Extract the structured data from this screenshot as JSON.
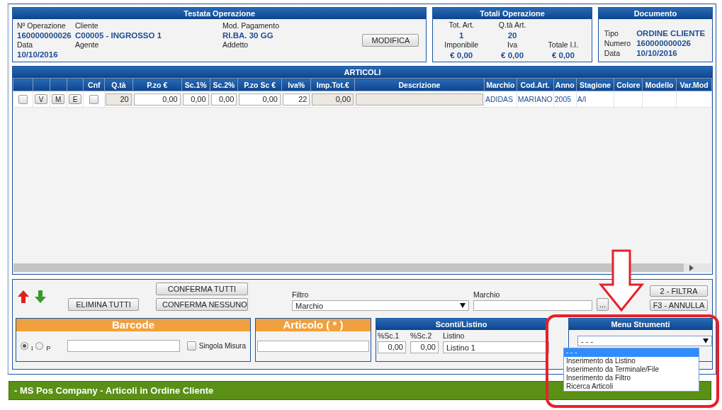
{
  "testata": {
    "title": "Testata Operazione",
    "fields": [
      {
        "label": "Nº Operazione",
        "value": "160000000026"
      },
      {
        "label": "Cliente",
        "value": "C00005 - INGROSSO 1"
      },
      {
        "label": "Mod. Pagamento",
        "value": "RI.BA. 30 GG"
      },
      {
        "label": "Data",
        "value": "10/10/2016"
      },
      {
        "label": "Agente"
      },
      {
        "label": "Addetto"
      }
    ],
    "button": "MODIFICA"
  },
  "totali": {
    "title": "Totali Operazione",
    "rows": [
      [
        {
          "label": "Tot. Art.",
          "value": "1"
        },
        {
          "label": "Q.tà Art.",
          "value": "20"
        }
      ],
      [
        {
          "label": "Imponibile",
          "value": "€ 0,00"
        },
        {
          "label": "Iva",
          "value": "€ 0,00"
        },
        {
          "label": "Totale I.I.",
          "value": "€ 0,00"
        }
      ]
    ]
  },
  "documento": {
    "title": "Documento",
    "fields": [
      {
        "label": "Tipo",
        "value": "ORDINE CLIENTE"
      },
      {
        "label": "Numero",
        "value": "160000000026"
      },
      {
        "label": "Data",
        "value": "10/10/2016"
      }
    ]
  },
  "articoli": {
    "title": "ARTICOLI",
    "columns": [
      {},
      {},
      {},
      {},
      {
        "label": "Cnf"
      },
      {
        "label": "Q.tà"
      },
      {
        "label": "P.zo €"
      },
      {
        "label": "Sc.1%"
      },
      {
        "label": "Sc.2%"
      },
      {
        "label": "P.zo Sc €"
      },
      {
        "label": "Iva%"
      },
      {
        "label": "Imp.Tot.€"
      },
      {
        "label": "Descrizione"
      },
      {
        "label": "Marchio"
      },
      {
        "label": "Cod.Art."
      },
      {
        "label": "Anno"
      },
      {
        "label": "Stagione"
      },
      {
        "label": "Colore"
      },
      {
        "label": "Modello"
      },
      {
        "label": "Var.Mod"
      }
    ],
    "rows": [
      [
        {
          "kind": "checkbox",
          "checked": false
        },
        {
          "kind": "button",
          "value": "V"
        },
        {
          "kind": "button",
          "value": "M"
        },
        {
          "kind": "button",
          "value": "E"
        },
        {
          "kind": "checkbox",
          "checked": false
        },
        {
          "kind": "readonly",
          "value": "20"
        },
        {
          "kind": "input",
          "value": "0,00"
        },
        {
          "kind": "input",
          "value": "0,00"
        },
        {
          "kind": "input",
          "value": "0,00"
        },
        {
          "kind": "input",
          "value": "0,00"
        },
        {
          "kind": "input",
          "value": "22"
        },
        {
          "kind": "readonly",
          "value": "0,00"
        },
        {
          "kind": "readonly"
        },
        {
          "kind": "text",
          "value": "ADIDAS"
        },
        {
          "kind": "text",
          "value": "MARIANO"
        },
        {
          "kind": "text",
          "value": "2005"
        },
        {
          "kind": "text",
          "value": "A/I"
        },
        {
          "kind": "text"
        },
        {
          "kind": "text"
        },
        {
          "kind": "text"
        }
      ]
    ]
  },
  "toolbar": {
    "elimina": "ELIMINA TUTTI",
    "conferma_tutti": "CONFERMA TUTTI",
    "conferma_nessuno": "CONFERMA NESSUNO",
    "filtro": {
      "label": "Filtro",
      "value": "Marchio"
    },
    "marchio": {
      "label": "Marchio",
      "button": "..."
    },
    "filtra": "2 - FILTRA",
    "annulla": "F3 - ANNULLA"
  },
  "barcode": {
    "title": "Barcode",
    "modes": [
      {
        "label": "I",
        "selected": true
      },
      {
        "label": "P",
        "selected": false
      }
    ],
    "singola_misura": {
      "label": "Singola Misura",
      "checked": false
    }
  },
  "articolo": {
    "title": "Articolo ( * )"
  },
  "sconti": {
    "title": "Sconti/Listino",
    "sc1": {
      "label": "%Sc.1",
      "value": "0,00"
    },
    "sc2": {
      "label": "%Sc.2",
      "value": "0,00"
    },
    "listino": {
      "label": "Listino",
      "value": "Listino 1"
    }
  },
  "menu": {
    "title": "Menu Strumenti",
    "value": "- - -",
    "options": [
      {
        "label": "- - -",
        "selected": true
      },
      {
        "label": "Inserimento da Listino",
        "selected": false
      },
      {
        "label": "Inserimento da Terminale/File",
        "selected": false
      },
      {
        "label": "Inserimento da Filtro",
        "selected": false
      },
      {
        "label": "Ricerca Articoli",
        "selected": false
      }
    ]
  },
  "footer": {
    "title": "- MS Pos Company - Articoli in Ordine Cliente"
  }
}
